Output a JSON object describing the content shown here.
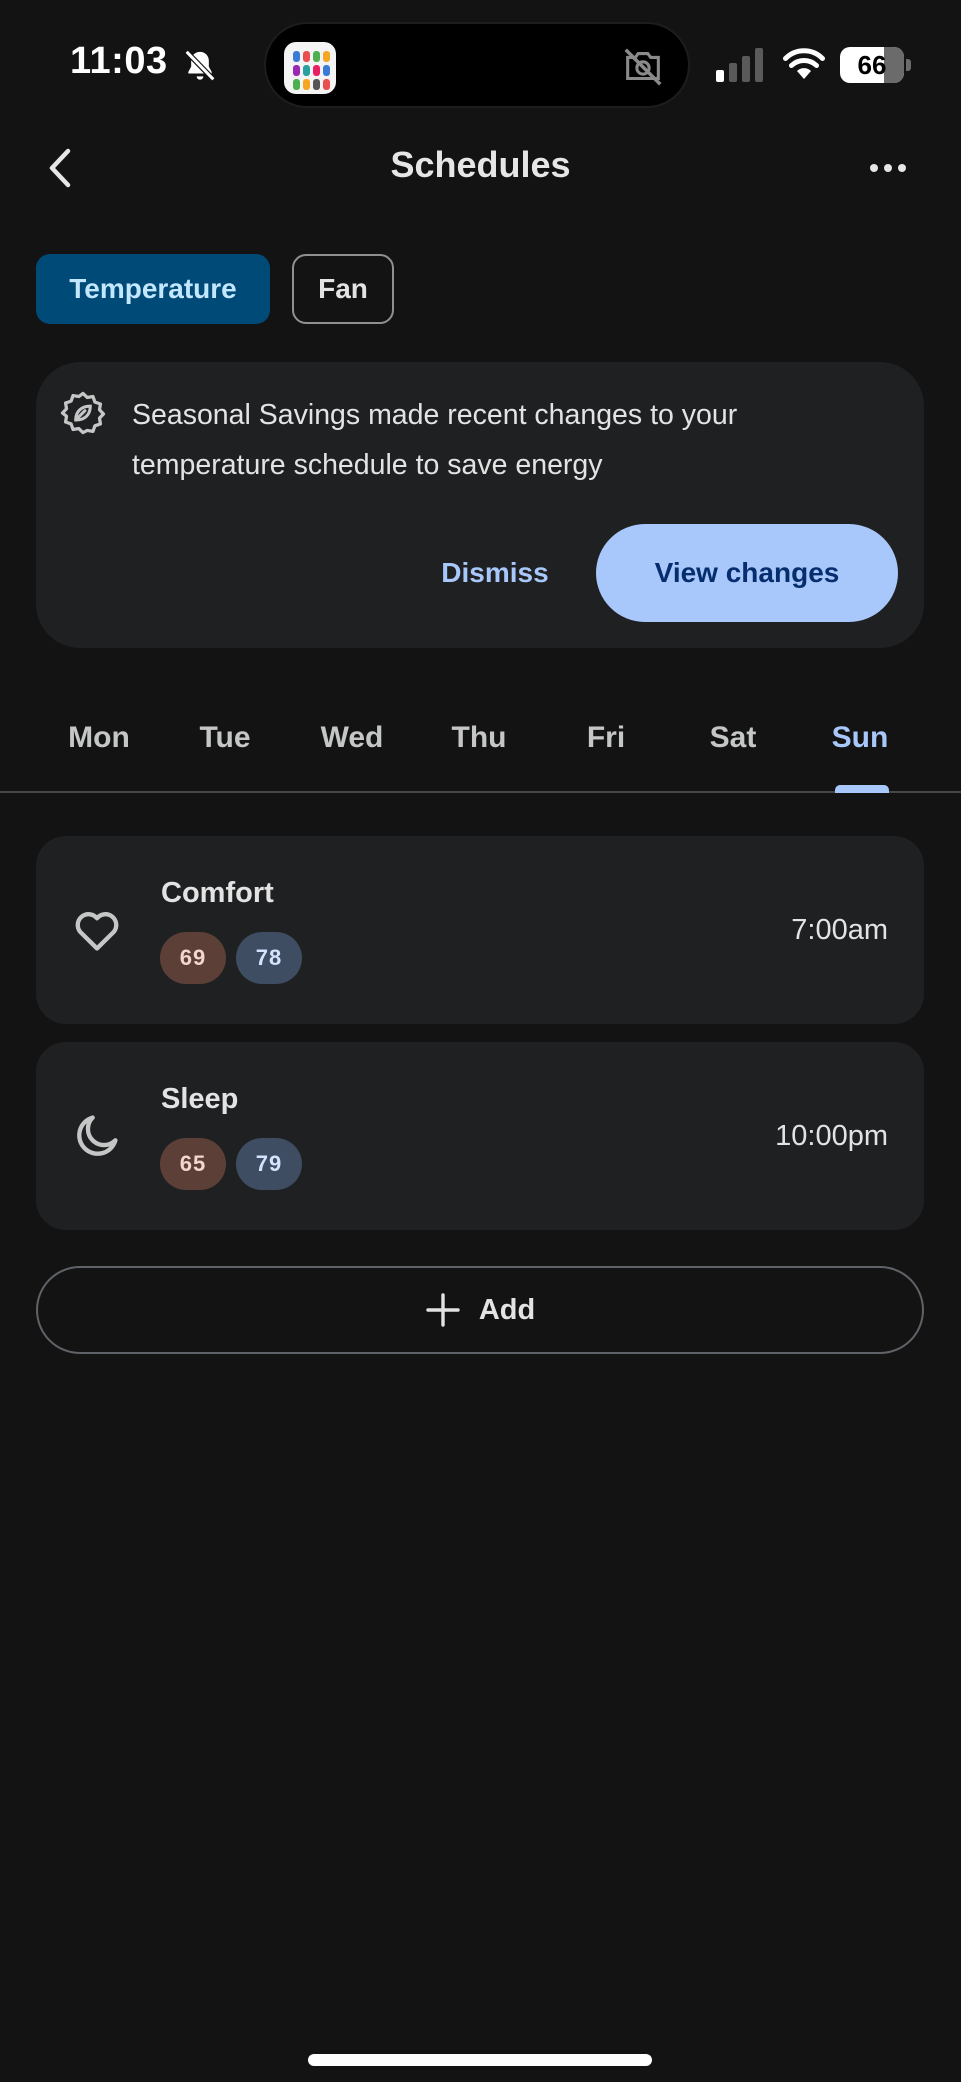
{
  "status_bar": {
    "time": "11:03",
    "battery": "66",
    "icons": [
      "bell-slash-icon",
      "dynamic-island-app-icon",
      "camera-off-icon",
      "signal-icon",
      "wifi-icon",
      "battery-icon"
    ]
  },
  "header": {
    "title": "Schedules",
    "back_icon": "chevron-left-icon",
    "more_icon": "more-horizontal-icon"
  },
  "chips": [
    {
      "label": "Temperature",
      "selected": true
    },
    {
      "label": "Fan",
      "selected": false
    }
  ],
  "banner": {
    "icon": "seasonal-savings-leaf-icon",
    "text": "Seasonal Savings made recent changes to your temperature schedule to save energy",
    "dismiss_label": "Dismiss",
    "view_label": "View changes"
  },
  "days": {
    "items": [
      "Mon",
      "Tue",
      "Wed",
      "Thu",
      "Fri",
      "Sat",
      "Sun"
    ],
    "selected": "Sun"
  },
  "schedules": [
    {
      "name": "Comfort",
      "icon": "heart-icon",
      "heat": "69",
      "cool": "78",
      "time": "7:00am"
    },
    {
      "name": "Sleep",
      "icon": "moon-icon",
      "heat": "65",
      "cool": "79",
      "time": "10:00pm"
    }
  ],
  "add_label": "Add",
  "colors": {
    "background": "#131314",
    "surface": "#1f2022",
    "accent": "#a8c7fa",
    "chip_selected": "#004a77",
    "heat_pill": "#5c3f36",
    "cool_pill": "#3e4d61"
  }
}
